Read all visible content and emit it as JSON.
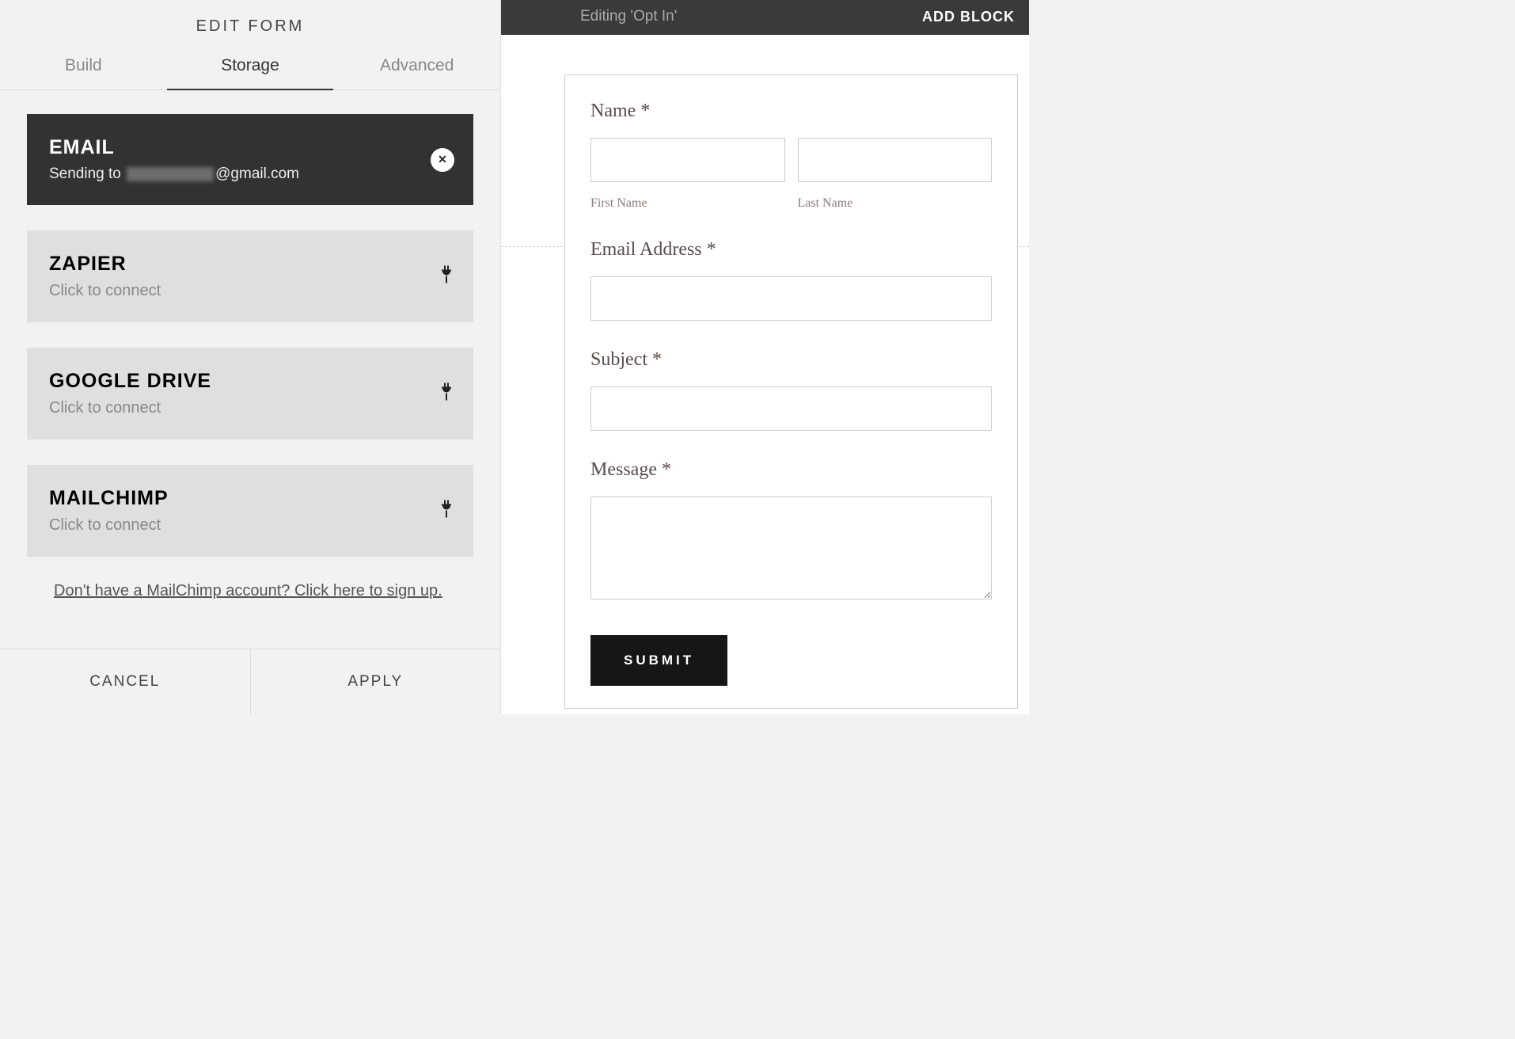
{
  "panel": {
    "title": "EDIT FORM",
    "tabs": [
      "Build",
      "Storage",
      "Advanced"
    ],
    "activeTab": 1,
    "storage": {
      "email": {
        "title": "EMAIL",
        "sending_prefix": "Sending to ",
        "sending_suffix": "@gmail.com"
      },
      "items": [
        {
          "title": "ZAPIER",
          "subtitle": "Click to connect"
        },
        {
          "title": "GOOGLE DRIVE",
          "subtitle": "Click to connect"
        },
        {
          "title": "MAILCHIMP",
          "subtitle": "Click to connect"
        }
      ],
      "signup_link": "Don't have a MailChimp account? Click here to sign up."
    },
    "footer": {
      "cancel": "CANCEL",
      "apply": "APPLY"
    }
  },
  "topbar": {
    "editing_label": "Editing 'Opt In'",
    "add_block": "ADD BLOCK"
  },
  "form_preview": {
    "name_label": "Name *",
    "first_name": "First Name",
    "last_name": "Last Name",
    "email_label": "Email Address *",
    "subject_label": "Subject *",
    "message_label": "Message *",
    "submit": "SUBMIT"
  }
}
